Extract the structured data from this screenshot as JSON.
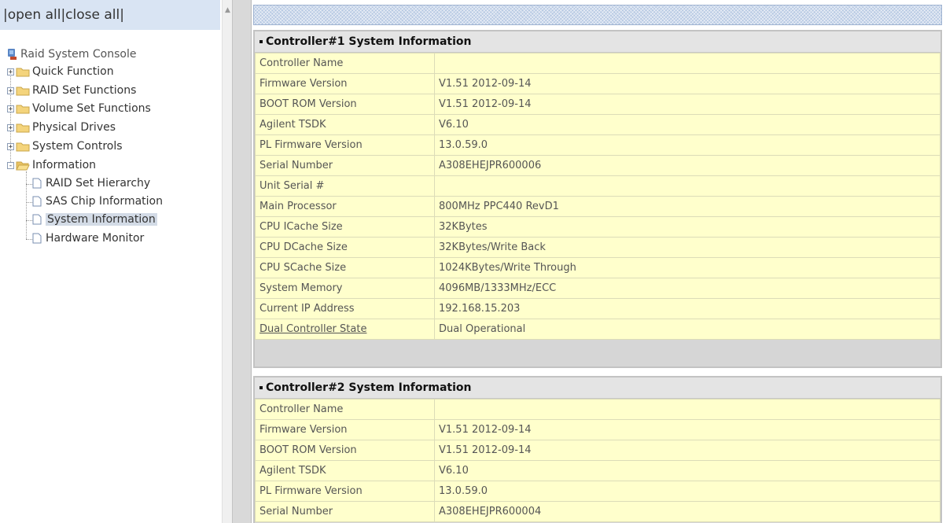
{
  "left_frame": {
    "toplinks": {
      "sep1": "|",
      "open_all": "open all",
      "sep2": "|",
      "close_all": "close all",
      "sep3": "|"
    },
    "tree": {
      "root": "Raid System Console",
      "folders": [
        {
          "label": "Quick Function",
          "expand": "+"
        },
        {
          "label": "RAID Set Functions",
          "expand": "+"
        },
        {
          "label": "Volume Set Functions",
          "expand": "+"
        },
        {
          "label": "Physical Drives",
          "expand": "+"
        },
        {
          "label": "System Controls",
          "expand": "+"
        },
        {
          "label": "Information",
          "expand": "-"
        }
      ],
      "info_items": [
        {
          "label": "RAID Set Hierarchy",
          "selected": false
        },
        {
          "label": "SAS Chip Information",
          "selected": false
        },
        {
          "label": "System Information",
          "selected": true
        },
        {
          "label": "Hardware Monitor",
          "selected": false
        }
      ]
    },
    "scroll_up_glyph": "▲"
  },
  "controller1": {
    "title": "Controller#1 System Information",
    "rows": [
      {
        "label": "Controller Name",
        "value": ""
      },
      {
        "label": "Firmware Version",
        "value": "V1.51 2012-09-14"
      },
      {
        "label": "BOOT ROM Version",
        "value": "V1.51 2012-09-14"
      },
      {
        "label": "Agilent TSDK",
        "value": "V6.10"
      },
      {
        "label": "PL Firmware Version",
        "value": "13.0.59.0"
      },
      {
        "label": "Serial Number",
        "value": "A308EHEJPR600006"
      },
      {
        "label": "Unit Serial #",
        "value": ""
      },
      {
        "label": "Main Processor",
        "value": "800MHz PPC440 RevD1"
      },
      {
        "label": "CPU ICache Size",
        "value": "32KBytes"
      },
      {
        "label": "CPU DCache Size",
        "value": "32KBytes/Write Back"
      },
      {
        "label": "CPU SCache Size",
        "value": "1024KBytes/Write Through"
      },
      {
        "label": "System Memory",
        "value": "4096MB/1333MHz/ECC"
      },
      {
        "label": "Current IP Address",
        "value": "192.168.15.203"
      },
      {
        "label": "Dual Controller State",
        "value": "Dual Operational",
        "link": true
      }
    ]
  },
  "controller2": {
    "title": "Controller#2 System Information",
    "rows": [
      {
        "label": "Controller Name",
        "value": ""
      },
      {
        "label": "Firmware Version",
        "value": "V1.51 2012-09-14"
      },
      {
        "label": "BOOT ROM Version",
        "value": "V1.51 2012-09-14"
      },
      {
        "label": "Agilent TSDK",
        "value": "V6.10"
      },
      {
        "label": "PL Firmware Version",
        "value": "13.0.59.0"
      },
      {
        "label": "Serial Number",
        "value": "A308EHEJPR600004"
      }
    ]
  },
  "colors": {
    "toplinks_bg": "#d9e4f3",
    "cell_bg": "#ffffcc",
    "panel_head_bg": "#e4e4e4",
    "selected_bg": "#d3dbe6"
  }
}
